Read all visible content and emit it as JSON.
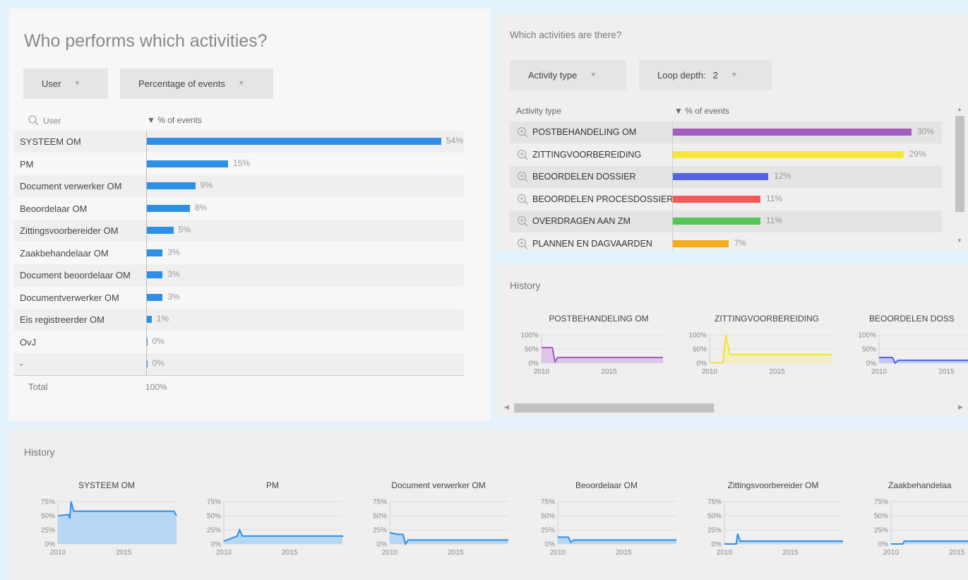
{
  "left": {
    "title": "Who performs which activities?",
    "dropdowns": {
      "group_by": "User",
      "measure": "Percentage of events"
    },
    "header": {
      "name_col": "User",
      "value_col": "▼ % of events"
    },
    "rows": [
      {
        "label": "SYSTEEM OM",
        "value": 54,
        "pct": "54%"
      },
      {
        "label": "PM",
        "value": 15,
        "pct": "15%"
      },
      {
        "label": "Document verwerker OM",
        "value": 9,
        "pct": "9%"
      },
      {
        "label": "Beoordelaar OM",
        "value": 8,
        "pct": "8%"
      },
      {
        "label": "Zittingsvoorbereider OM",
        "value": 5,
        "pct": "5%"
      },
      {
        "label": "Zaakbehandelaar OM",
        "value": 3,
        "pct": "3%"
      },
      {
        "label": "Document beoordelaar OM",
        "value": 3,
        "pct": "3%"
      },
      {
        "label": "Documentverwerker OM",
        "value": 3,
        "pct": "3%"
      },
      {
        "label": "Eis registreerder OM",
        "value": 1,
        "pct": "1%"
      },
      {
        "label": "OvJ",
        "value": 0.1,
        "pct": "0%"
      },
      {
        "label": "-",
        "value": 0.1,
        "pct": "0%"
      }
    ],
    "total": {
      "label": "Total",
      "value": "100%"
    }
  },
  "activities": {
    "title": "Which activities are there?",
    "dropdowns": {
      "type": "Activity type",
      "loop_label": "Loop depth:",
      "loop_value": "2"
    },
    "header": {
      "name_col": "Activity type",
      "value_col": "▼ % of events"
    },
    "rows": [
      {
        "label": "POSTBEHANDELING OM",
        "value": 30,
        "pct": "30%",
        "color": "#a35cc0"
      },
      {
        "label": "ZITTINGVOORBEREIDING",
        "value": 29,
        "pct": "29%",
        "color": "#f7e73c"
      },
      {
        "label": "BEOORDELEN DOSSIER",
        "value": 12,
        "pct": "12%",
        "color": "#5463e6"
      },
      {
        "label": "BEOORDELEN PROCESDOSSIER",
        "value": 11,
        "pct": "11%",
        "color": "#f45a5a"
      },
      {
        "label": "OVERDRAGEN AAN ZM",
        "value": 11,
        "pct": "11%",
        "color": "#55c65a"
      },
      {
        "label": "PLANNEN EN DAGVAARDEN",
        "value": 7,
        "pct": "7%",
        "color": "#f7ab1e"
      }
    ]
  },
  "activity_history": {
    "title": "History",
    "yticks": [
      "100%",
      "50%",
      "0%"
    ],
    "xticks": [
      "2010",
      "2015"
    ],
    "charts": [
      {
        "title": "POSTBEHANDELING OM",
        "color": "#a35cc0",
        "fill": "#dcc6e6",
        "points": [
          [
            2010.0,
            55
          ],
          [
            2010.8,
            55
          ],
          [
            2011.0,
            5
          ],
          [
            2011.2,
            20
          ],
          [
            2019.0,
            20
          ]
        ]
      },
      {
        "title": "ZITTINGVOORBEREIDING",
        "color": "#f2e23a",
        "fill": "#f5f0bb",
        "points": [
          [
            2010.0,
            2
          ],
          [
            2011.0,
            2
          ],
          [
            2011.2,
            100
          ],
          [
            2011.5,
            30
          ],
          [
            2019.0,
            30
          ],
          [
            2019.0,
            26
          ]
        ]
      },
      {
        "title": "BEOORDELEN DOSS",
        "color": "#5463e6",
        "fill": "#c4c8ef",
        "points": [
          [
            2010.0,
            20
          ],
          [
            2011.0,
            20
          ],
          [
            2011.2,
            0
          ],
          [
            2011.4,
            10
          ],
          [
            2019.0,
            10
          ]
        ]
      }
    ]
  },
  "user_history": {
    "title": "History",
    "yticks": [
      "75%",
      "50%",
      "25%",
      "0%"
    ],
    "xticks": [
      "2010",
      "2015"
    ],
    "color": "#2e8fe6",
    "charts": [
      {
        "title": "SYSTEEM OM",
        "points": [
          [
            2010.0,
            50
          ],
          [
            2010.8,
            52
          ],
          [
            2010.9,
            45
          ],
          [
            2011.0,
            75
          ],
          [
            2011.2,
            58
          ],
          [
            2018.8,
            58
          ],
          [
            2019.0,
            50
          ]
        ]
      },
      {
        "title": "PM",
        "points": [
          [
            2010.0,
            5
          ],
          [
            2010.8,
            12
          ],
          [
            2011.0,
            14
          ],
          [
            2011.2,
            25
          ],
          [
            2011.4,
            14
          ],
          [
            2019.0,
            14
          ],
          [
            2019.0,
            12
          ]
        ]
      },
      {
        "title": "Document verwerker OM",
        "points": [
          [
            2010.0,
            20
          ],
          [
            2010.6,
            17
          ],
          [
            2011.0,
            17
          ],
          [
            2011.2,
            0
          ],
          [
            2011.4,
            7
          ],
          [
            2019.0,
            7
          ]
        ]
      },
      {
        "title": "Beoordelaar OM",
        "points": [
          [
            2010.0,
            12
          ],
          [
            2010.8,
            12
          ],
          [
            2011.0,
            3
          ],
          [
            2011.2,
            7
          ],
          [
            2019.0,
            7
          ]
        ]
      },
      {
        "title": "Zittingsvoorbereider OM",
        "points": [
          [
            2010.0,
            0
          ],
          [
            2010.9,
            0
          ],
          [
            2011.0,
            18
          ],
          [
            2011.2,
            5
          ],
          [
            2019.0,
            5
          ]
        ]
      },
      {
        "title": "Zaakbehandelaa",
        "points": [
          [
            2010.0,
            0
          ],
          [
            2010.9,
            0
          ],
          [
            2011.0,
            5
          ],
          [
            2019.0,
            5
          ]
        ]
      }
    ]
  }
}
